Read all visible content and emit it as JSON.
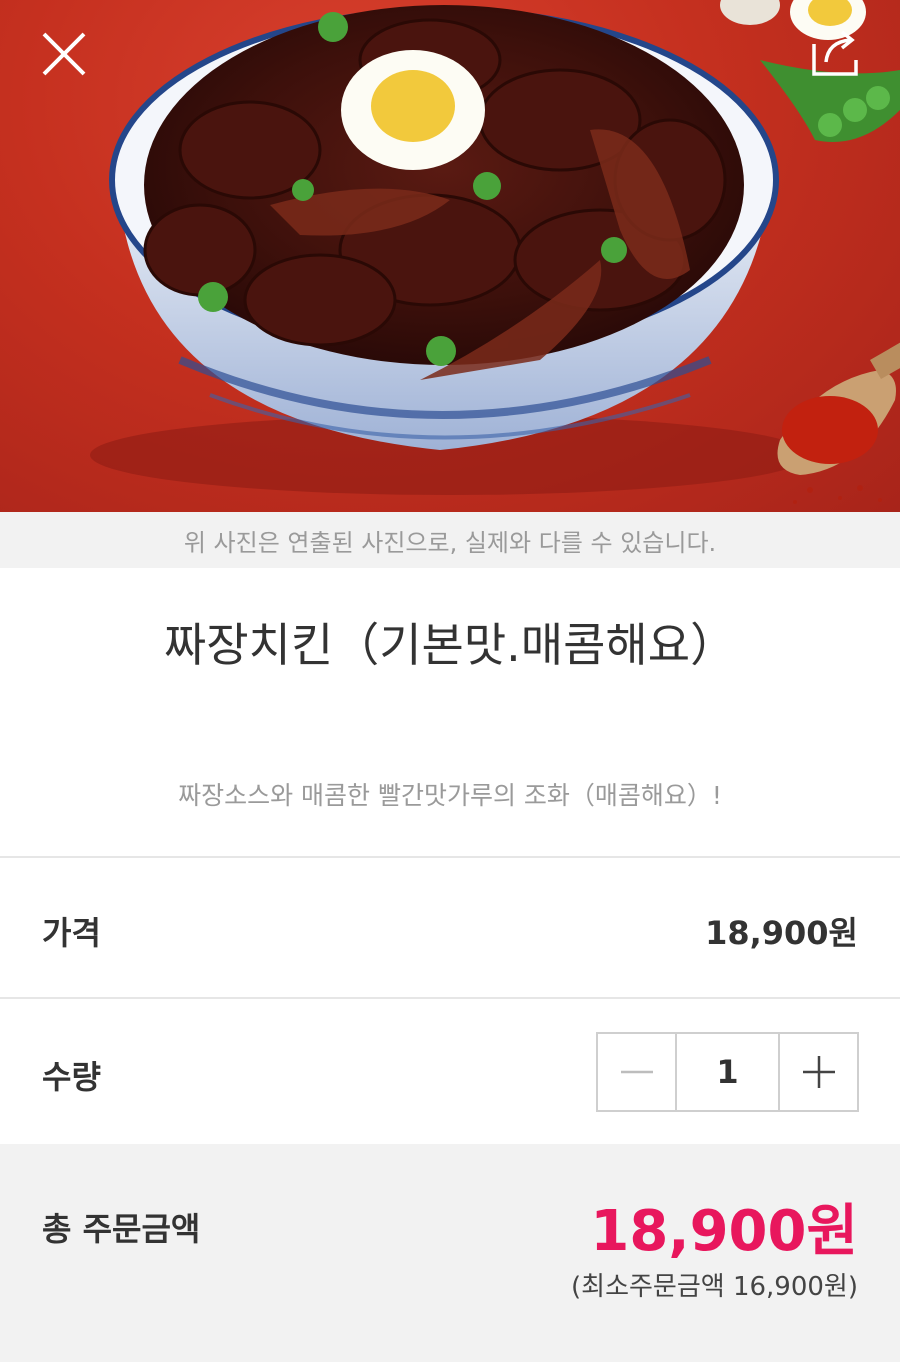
{
  "hero": {
    "image_alt": "짜장치킨 사진",
    "close_icon": "close-icon",
    "share_icon": "share-icon"
  },
  "photo_note": "위 사진은 연출된 사진으로, 실제와 다를 수 있습니다.",
  "product": {
    "title": "짜장치킨（기본맛.매콤해요）",
    "description": "짜장소스와 매콤한 빨간맛가루의 조화（매콤해요）!"
  },
  "price": {
    "label": "가격",
    "value": "18,900원"
  },
  "quantity": {
    "label": "수량",
    "value": "1",
    "decrement_icon": "minus-icon",
    "increment_icon": "plus-icon"
  },
  "total": {
    "label": "총 주문금액",
    "value": "18,900원",
    "min_order": "(최소주문금액 16,900원)"
  },
  "colors": {
    "accent": "#e8175d",
    "hero_bg": "#c5301f",
    "section_bg": "#f2f2f2"
  }
}
